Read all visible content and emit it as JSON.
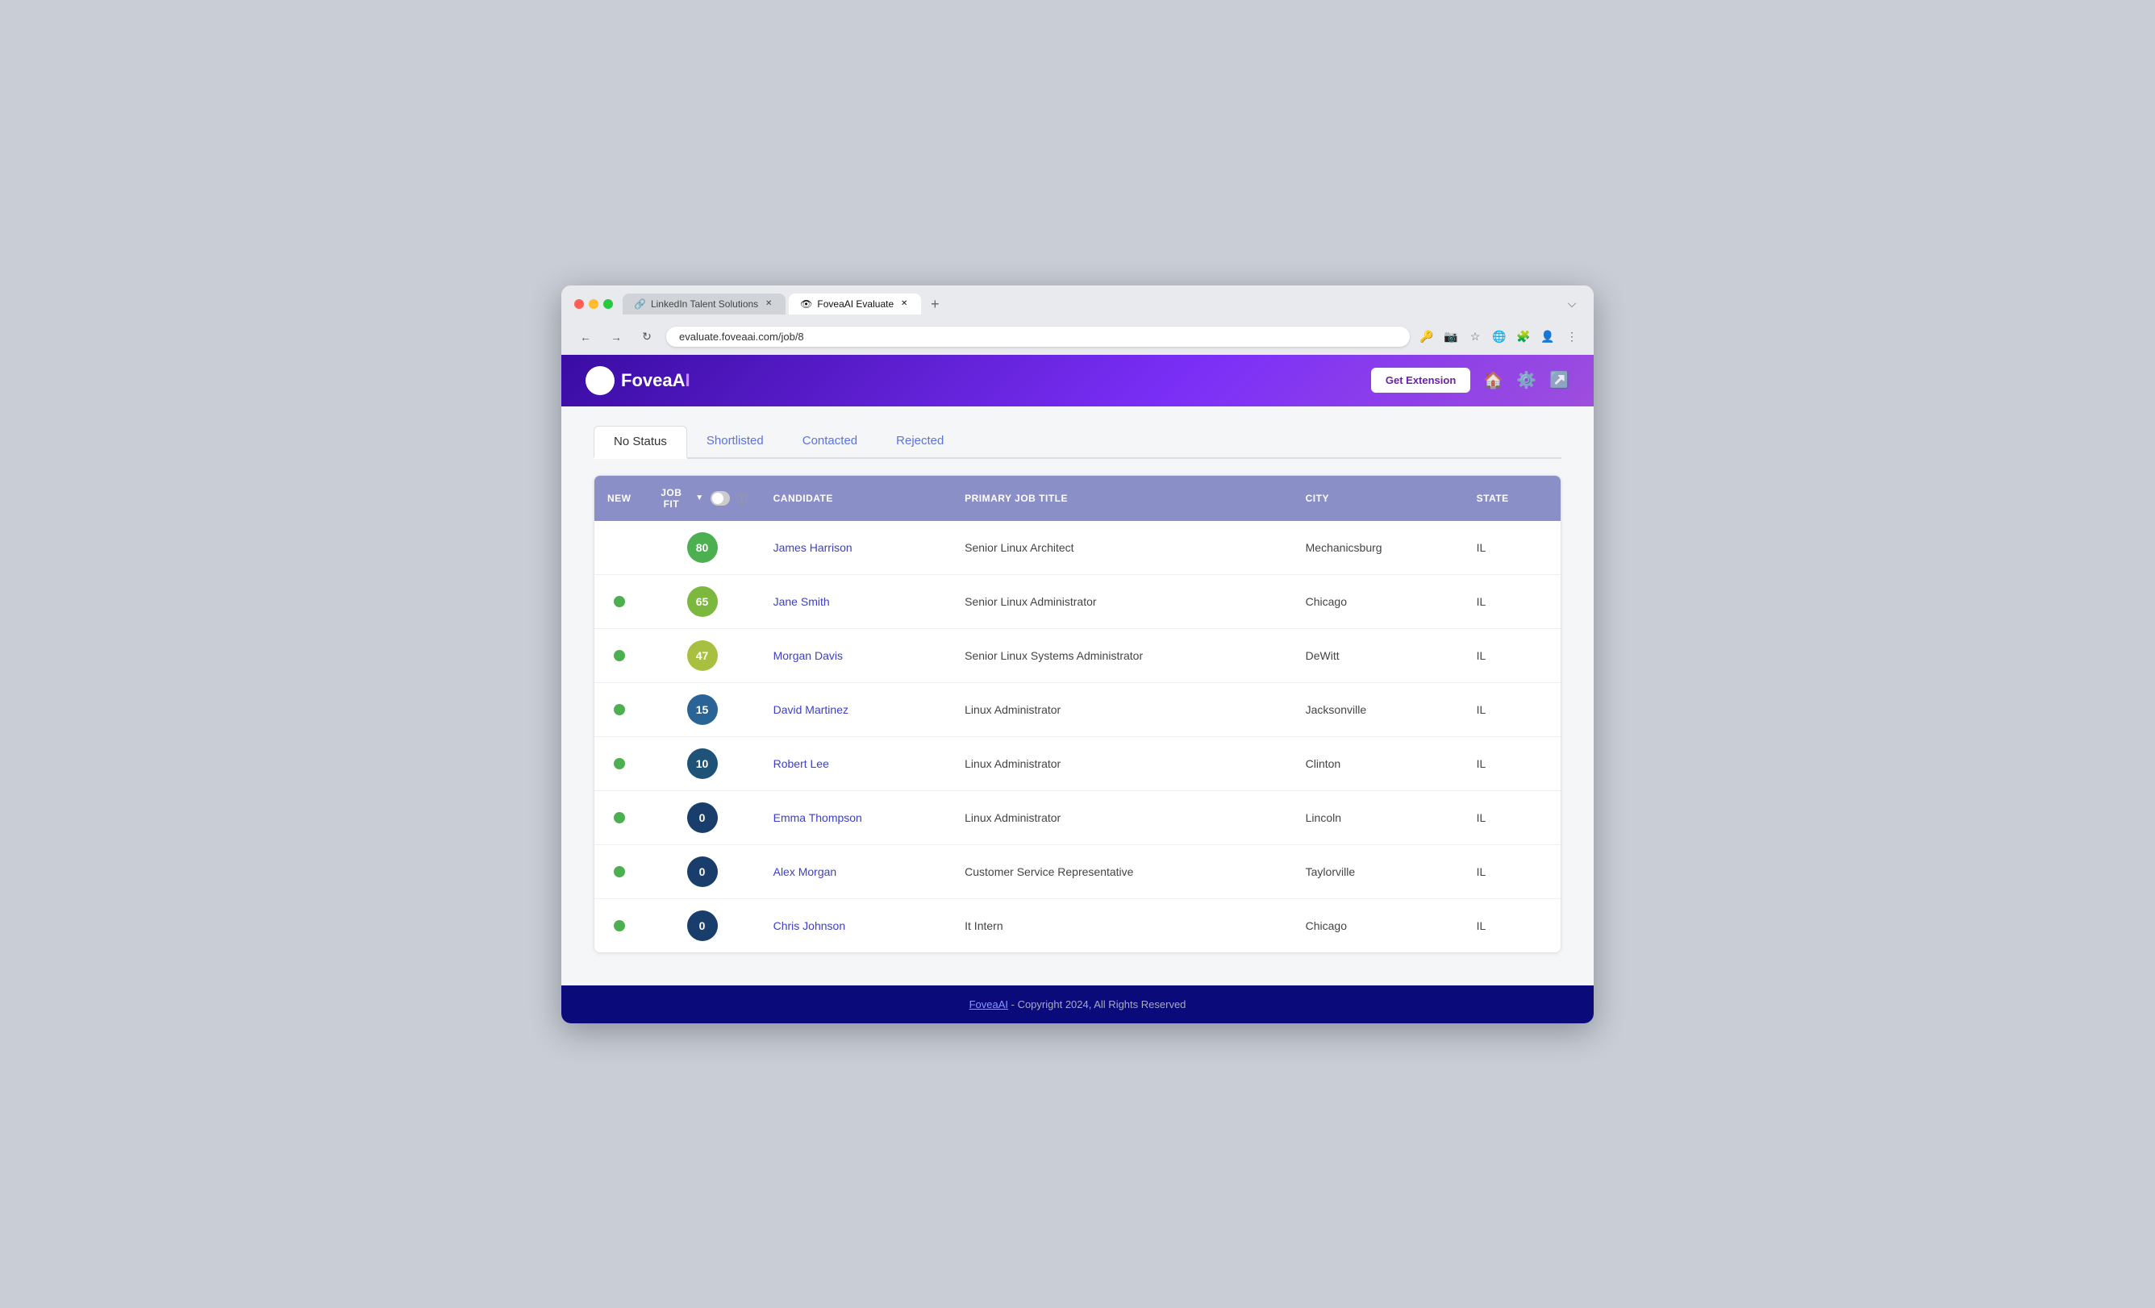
{
  "browser": {
    "url": "evaluate.foveaai.com/job/8",
    "tabs": [
      {
        "id": "tab-linkedin",
        "label": "LinkedIn Talent Solutions",
        "active": false,
        "favicon": "🔗"
      },
      {
        "id": "tab-fovea",
        "label": "FoveaAI Evaluate",
        "active": true,
        "favicon": "👁"
      }
    ],
    "new_tab_icon": "+",
    "nav": {
      "back": "←",
      "forward": "→",
      "refresh": "↻"
    }
  },
  "header": {
    "logo_text": "FoveaA",
    "logo_suffix": "I",
    "get_extension_label": "Get Extension"
  },
  "status_tabs": [
    {
      "id": "tab-no-status",
      "label": "No Status",
      "active": true
    },
    {
      "id": "tab-shortlisted",
      "label": "Shortlisted",
      "active": false
    },
    {
      "id": "tab-contacted",
      "label": "Contacted",
      "active": false
    },
    {
      "id": "tab-rejected",
      "label": "Rejected",
      "active": false
    }
  ],
  "table": {
    "columns": [
      {
        "id": "new",
        "label": "NEW"
      },
      {
        "id": "job_fit",
        "label": "JOB FIT"
      },
      {
        "id": "candidate",
        "label": "CANDIDATE"
      },
      {
        "id": "primary_job_title",
        "label": "PRIMARY JOB TITLE"
      },
      {
        "id": "city",
        "label": "CITY"
      },
      {
        "id": "state",
        "label": "STATE"
      }
    ],
    "rows": [
      {
        "id": "row-1",
        "new": false,
        "fit_score": 80,
        "fit_color": "#4caf50",
        "name": "James Harrison",
        "title": "Senior Linux Architect",
        "city": "Mechanicsburg",
        "state": "IL"
      },
      {
        "id": "row-2",
        "new": true,
        "fit_score": 65,
        "fit_color": "#7cb83e",
        "name": "Jane Smith",
        "title": "Senior Linux Administrator",
        "city": "Chicago",
        "state": "IL"
      },
      {
        "id": "row-3",
        "new": true,
        "fit_score": 47,
        "fit_color": "#a8c040",
        "name": "Morgan Davis",
        "title": "Senior Linux Systems Administrator",
        "city": "DeWitt",
        "state": "IL"
      },
      {
        "id": "row-4",
        "new": true,
        "fit_score": 15,
        "fit_color": "#2a6496",
        "name": "David Martinez",
        "title": "Linux Administrator",
        "city": "Jacksonville",
        "state": "IL"
      },
      {
        "id": "row-5",
        "new": true,
        "fit_score": 10,
        "fit_color": "#1e5276",
        "name": "Robert Lee",
        "title": "Linux Administrator",
        "city": "Clinton",
        "state": "IL"
      },
      {
        "id": "row-6",
        "new": true,
        "fit_score": 0,
        "fit_color": "#1a3e6c",
        "name": "Emma Thompson",
        "title": "Linux Administrator",
        "city": "Lincoln",
        "state": "IL"
      },
      {
        "id": "row-7",
        "new": true,
        "fit_score": 0,
        "fit_color": "#1a3e6c",
        "name": "Alex Morgan",
        "title": "Customer Service Representative",
        "city": "Taylorville",
        "state": "IL"
      },
      {
        "id": "row-8",
        "new": true,
        "fit_score": 0,
        "fit_color": "#1a3e6c",
        "name": "Chris Johnson",
        "title": "It Intern",
        "city": "Chicago",
        "state": "IL"
      }
    ]
  },
  "footer": {
    "link_text": "FoveaAI",
    "copyright_text": " - Copyright 2024, All Rights Reserved"
  }
}
